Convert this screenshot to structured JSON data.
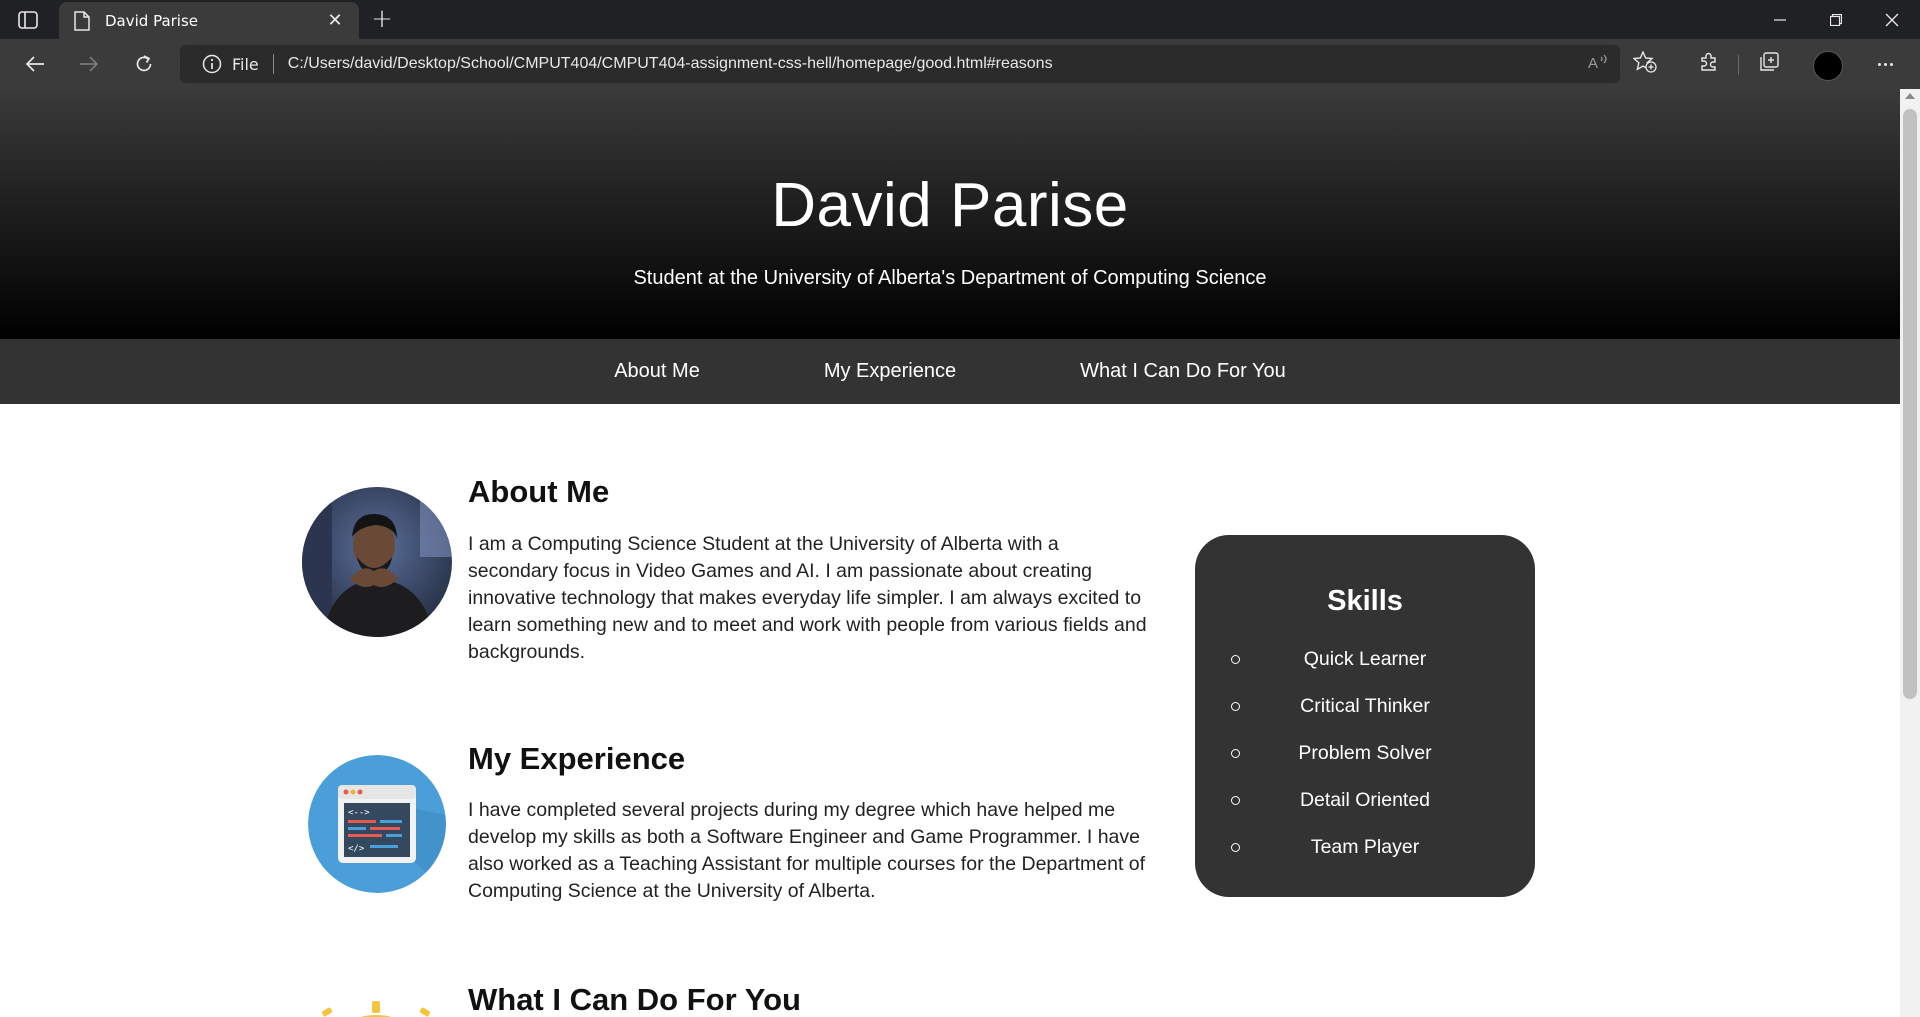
{
  "browser": {
    "tab_title": "David Parise",
    "address_scheme": "File",
    "url": "C:/Users/david/Desktop/School/CMPUT404/CMPUT404-assignment-css-hell/homepage/good.html#reasons",
    "icons": [
      "tab-actions-icon",
      "document-icon",
      "close-icon",
      "plus-icon",
      "minimize-icon",
      "restore-icon",
      "close-window-icon",
      "back-arrow-icon",
      "forward-arrow-icon",
      "refresh-icon",
      "info-icon",
      "read-aloud-icon",
      "add-favorite-icon",
      "extensions-icon",
      "collections-icon",
      "more-icon"
    ]
  },
  "header": {
    "title": "David Parise",
    "subtitle": "Student at the University of Alberta's Department of Computing Science"
  },
  "nav": {
    "items": [
      "About Me",
      "My Experience",
      "What I Can Do For You"
    ]
  },
  "sections": [
    {
      "heading": "About Me",
      "text": "I am a Computing Science Student at the University of Alberta with a secondary focus in Video Games and AI. I am passionate about creating innovative technology that makes everyday life simpler. I am always excited to learn something new and to meet and work with people from various fields and backgrounds."
    },
    {
      "heading": "My Experience",
      "text": "I have completed several projects during my degree which have helped me develop my skills as both a Software Engineer and Game Programmer. I have also worked as a Teaching Assistant for multiple courses for the Department of Computing Science at the University of Alberta."
    },
    {
      "heading": "What I Can Do For You",
      "text": ""
    }
  ],
  "skills": {
    "title": "Skills",
    "items": [
      "Quick Learner",
      "Critical Thinker",
      "Problem Solver",
      "Detail Oriented",
      "Team Player"
    ]
  },
  "colors": {
    "chrome_dark": "#202124",
    "chrome_toolbar": "#3b3b3b",
    "nav_bg": "#333333",
    "skills_bg": "#333333",
    "code_icon_blue": "#4a9fd8"
  }
}
